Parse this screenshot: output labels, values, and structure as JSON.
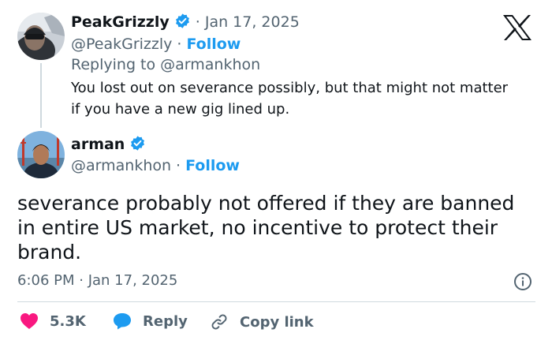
{
  "reply_tweet": {
    "author_name": "PeakGrizzly",
    "date": "· Jan 17, 2025",
    "handle": "@PeakGrizzly",
    "separator": "·",
    "follow_label": "Follow",
    "replying_prefix": "Replying to",
    "replying_to": "@armankhon",
    "text_line1": "You lost out on severance possibly, but that might not matter",
    "text_line2": "if you have a new gig lined up."
  },
  "main_tweet": {
    "author_name": "arman",
    "handle": "@armankhon",
    "separator": "·",
    "follow_label": "Follow",
    "text_line1": "severance probably not offered if they are banned",
    "text_line2": "in entire US market, no incentive to protect their",
    "text_line3": "brand.",
    "timestamp": "6:06 PM · Jan 17, 2025"
  },
  "actions": {
    "likes": "5.3K",
    "reply_label": "Reply",
    "copy_link_label": "Copy link"
  },
  "colors": {
    "accent": "#1d9bf0",
    "like": "#f91880",
    "text": "#0f1419",
    "muted": "#536471",
    "border": "#cfd9de"
  },
  "icons": [
    "x-logo-icon",
    "verified-badge-icon",
    "heart-icon",
    "reply-bubble-icon",
    "link-icon",
    "info-icon"
  ]
}
